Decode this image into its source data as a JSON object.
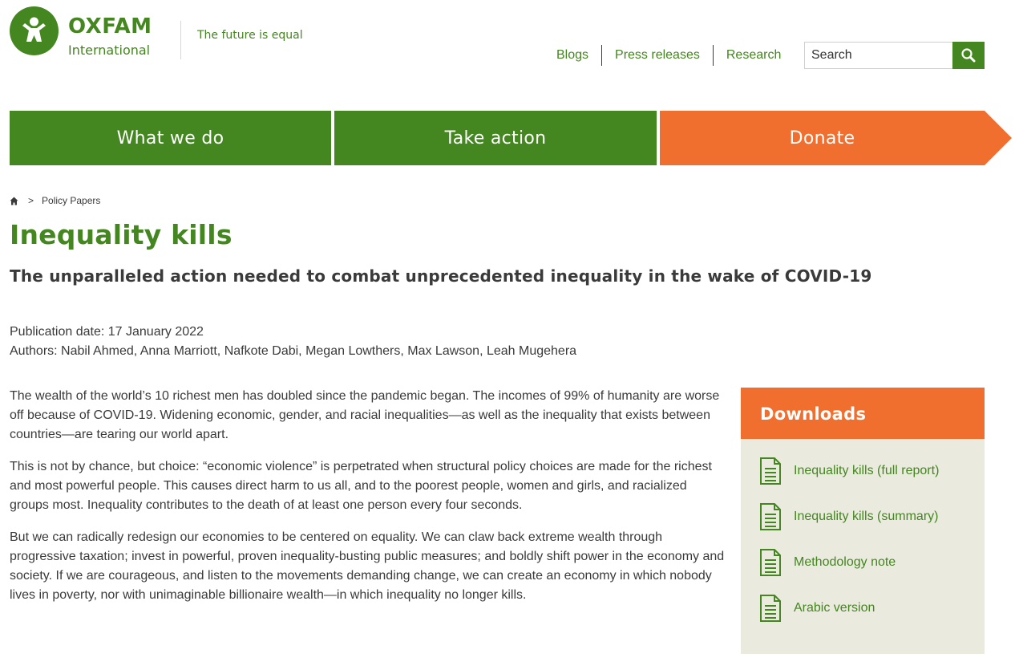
{
  "brand": {
    "name": "OXFAM",
    "sub": "International",
    "tagline": "The future is equal",
    "color_green": "#44861f",
    "color_orange": "#f06e2e"
  },
  "top_links": [
    {
      "label": "Blogs"
    },
    {
      "label": "Press releases"
    },
    {
      "label": "Research"
    }
  ],
  "search": {
    "placeholder": "Search",
    "icon": "search-icon"
  },
  "nav": {
    "what_we_do": "What we do",
    "take_action": "Take action",
    "donate": "Donate"
  },
  "breadcrumb": {
    "home_icon": "home-icon",
    "separator": ">",
    "current": "Policy Papers"
  },
  "page": {
    "title": "Inequality kills",
    "subtitle": "The unparalleled action needed to combat unprecedented inequality in the wake of COVID-19",
    "publication_date": "Publication date: 17 January 2022",
    "authors": "Authors: Nabil Ahmed, Anna Marriott, Nafkote Dabi, Megan Lowthers, Max Lawson, Leah Mugehera"
  },
  "body": {
    "p1": "The wealth of the  world’s 10 richest men has doubled since the pandemic began. The incomes of 99% of humanity are worse off because of COVID-19. Widening economic, gender, and racial inequalities—as well as the inequality that exists between countries—are tearing our world apart.",
    "p2": "This is not by chance, but choice: “economic violence” is perpetrated when structural policy choices are made for the richest and most powerful people. This causes direct harm to us all, and to the poorest people, women and girls, and racialized groups most. Inequality contributes to the death of at least one person every four seconds.",
    "p3": "But we can radically redesign our economies to be centered on equality. We can claw back extreme wealth through progressive taxation; invest in powerful, proven inequality-busting public measures; and boldly shift power in the economy and society. If we are courageous, and listen to the movements demanding change, we can create an economy in which nobody lives in poverty, nor with unimaginable billionaire wealth—in which inequality no longer kills."
  },
  "downloads": {
    "title": "Downloads",
    "icon": "document-icon",
    "items": [
      {
        "label": "Inequality kills (full report)"
      },
      {
        "label": "Inequality kills (summary)"
      },
      {
        "label": "Methodology note"
      },
      {
        "label": "Arabic version"
      }
    ]
  }
}
